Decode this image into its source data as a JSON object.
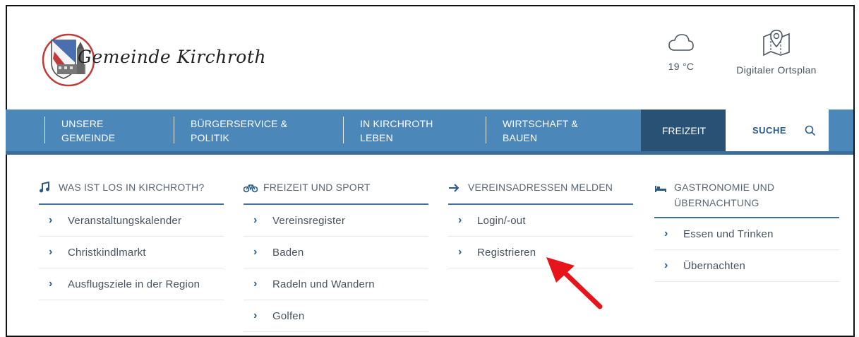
{
  "header": {
    "logo_text": "Gemeinde Kirchroth",
    "weather": {
      "temperature": "19 °C",
      "icon": "cloud-icon"
    },
    "ortsplan": {
      "label": "Digitaler Ortsplan",
      "icon": "map-pin-icon"
    }
  },
  "nav": {
    "items": [
      {
        "line1": "UNSERE",
        "line2": "GEMEINDE"
      },
      {
        "line1": "BÜRGERSERVICE &",
        "line2": "POLITIK"
      },
      {
        "line1": "IN KIRCHROTH",
        "line2": "LEBEN"
      },
      {
        "line1": "WIRTSCHAFT &",
        "line2": "BAUEN"
      }
    ],
    "active": "FREIZEIT",
    "search_label": "SUCHE"
  },
  "columns": [
    {
      "icon": "music-note-icon",
      "heading": "WAS IST LOS IN KIRCHROTH?",
      "items": [
        "Veranstaltungskalender",
        "Christkindlmarkt",
        "Ausflugsziele in der Region"
      ]
    },
    {
      "icon": "bicycle-icon",
      "heading": "FREIZEIT UND SPORT",
      "items": [
        "Vereinsregister",
        "Baden",
        "Radeln und Wandern",
        "Golfen"
      ]
    },
    {
      "icon": "arrow-right-icon",
      "heading": "VEREINSADRESSEN MELDEN",
      "items": [
        "Login/-out",
        "Registrieren"
      ]
    },
    {
      "icon": "bed-icon",
      "heading_line1": "GASTRONOMIE UND",
      "heading_line2": "ÜBERNACHTUNG",
      "items": [
        "Essen und Trinken",
        "Übernachten"
      ]
    }
  ],
  "colors": {
    "nav_bg": "#4c87b9",
    "nav_active": "#285174",
    "annotation_arrow": "#e8141b"
  }
}
